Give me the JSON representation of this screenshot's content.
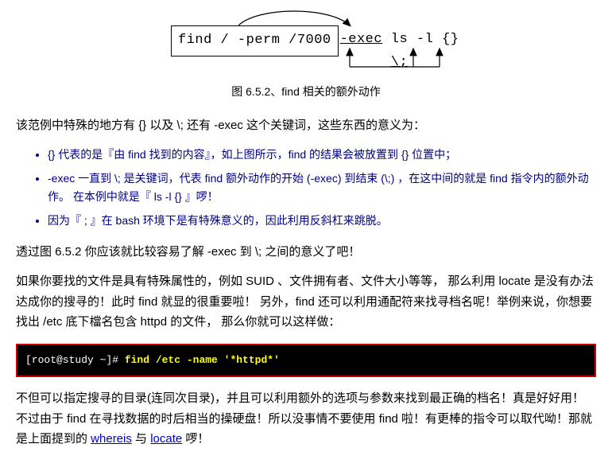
{
  "diagram": {
    "boxed_command": "find / -perm /7000",
    "exec_part": "-exec",
    "ls_part": " ls -l {} ",
    "terminator": "\\;"
  },
  "caption": "图 6.5.2、find 相关的额外动作",
  "para1": "该范例中特殊的地方有  {}  以及 \\;  还有  -exec  这个关键词，这些东西的意义为：",
  "bullets": [
    "{}  代表的是『由 find 找到的内容』，如上图所示，find  的结果会被放置到  {}  位置中；",
    "-exec  一直到 \\;  是关键词，代表 find 额外动作的开始 (-exec) 到结束 (\\;) ，在这中间的就是 find  指令内的额外动作。  在本例中就是『 ls -l {} 』啰！",
    "因为『 ; 』在 bash 环境下是有特殊意义的，因此利用反斜杠来跳脱。"
  ],
  "para2": "透过图  6.5.2  你应该就比较容易了解  -exec  到  \\;  之间的意义了吧！",
  "para3": "如果你要找的文件是具有特殊属性的，例如 SUID 、文件拥有者、文件大小等等， 那么利用 locate 是没有办法达成你的搜寻的！此时 find 就显的很重要啦！ 另外，find 还可以利用通配符来找寻档名呢！举例来说，你想要找出 /etc 底下檔名包含 httpd 的文件， 那么你就可以这样做：",
  "terminal": {
    "prompt": "[root@study ~]# ",
    "command": "find /etc -name '*httpd*'"
  },
  "para4_prefix": "不但可以指定搜寻的目录(连同次目录)，并且可以利用额外的选项与参数来找到最正确的档名！真是好好用！ 不过由于 find 在寻找数据的时后相当的操硬盘！所以没事情不要使用 find 啦！有更棒的指令可以取代呦！那就是上面提到的 ",
  "links": {
    "whereis": "whereis",
    "and": " 与 ",
    "locate": "locate",
    "suffix": " 啰！"
  }
}
